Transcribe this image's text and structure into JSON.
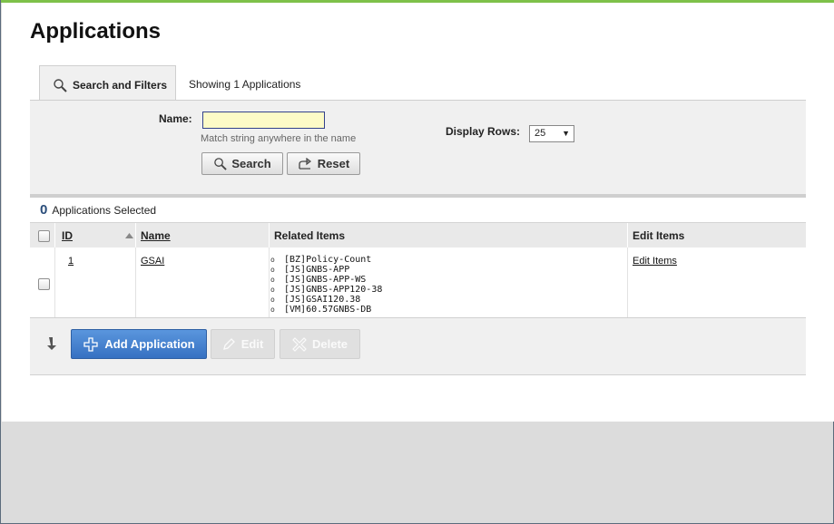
{
  "page": {
    "title": "Applications"
  },
  "tabs": {
    "active_label": "Search and Filters",
    "info": "Showing 1 Applications"
  },
  "filters": {
    "name_label": "Name:",
    "name_value": "",
    "name_hint": "Match string anywhere in the name",
    "search_label": "Search",
    "reset_label": "Reset",
    "rows_label": "Display Rows:",
    "rows_value": "25"
  },
  "selection": {
    "count": "0",
    "label": "Applications Selected"
  },
  "table": {
    "headers": {
      "id": "ID",
      "name": "Name",
      "related": "Related Items",
      "edit": "Edit Items"
    },
    "rows": [
      {
        "id": "1",
        "name": "GSAI",
        "related": [
          "[BZ]Policy-Count",
          "[JS]GNBS-APP",
          "[JS]GNBS-APP-WS",
          "[JS]GNBS-APP120-38",
          "[JS]GSAI120.38",
          "[VM]60.57GNBS-DB"
        ],
        "edit_link": "Edit Items"
      }
    ]
  },
  "actions": {
    "add_label": "Add Application",
    "edit_label": "Edit",
    "delete_label": "Delete"
  },
  "colors": {
    "accent_bar": "#7ec14a",
    "primary_button": "#3d7cd0",
    "input_bg": "#fdfbc7"
  },
  "icons": {
    "search": "magnifier-icon",
    "reset": "reset-arrow-icon",
    "add": "plus-icon",
    "edit": "pencil-icon",
    "delete": "x-icon",
    "bulk": "down-arrow-icon",
    "sort": "sort-asc-icon"
  }
}
